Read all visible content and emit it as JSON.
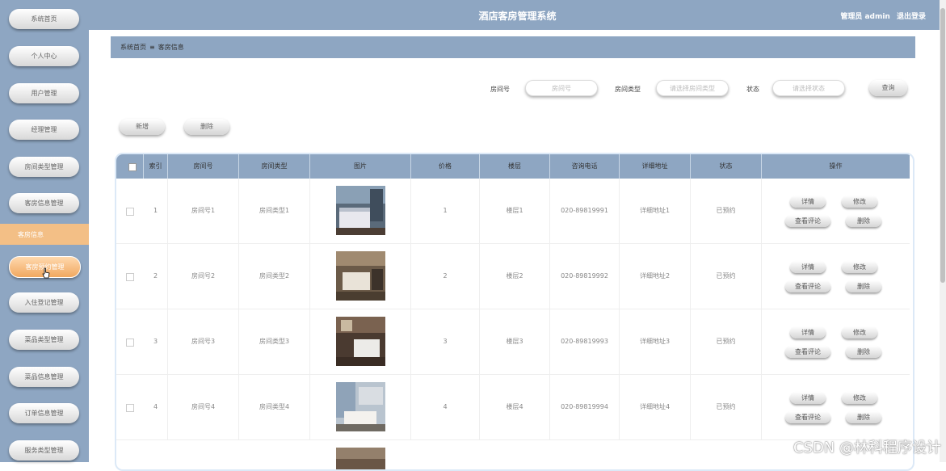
{
  "app": {
    "title": "酒店客房管理系统",
    "user_label": "管理员 admin",
    "logout": "退出登录"
  },
  "sidebar": {
    "items": [
      {
        "label": "系统首页"
      },
      {
        "label": "个人中心"
      },
      {
        "label": "用户管理"
      },
      {
        "label": "经理管理"
      },
      {
        "label": "房间类型管理"
      },
      {
        "label": "客房信息管理"
      },
      {
        "label": "客房预约管理"
      },
      {
        "label": "入住登记管理"
      },
      {
        "label": "菜品类型管理"
      },
      {
        "label": "菜品信息管理"
      },
      {
        "label": "订单信息管理"
      },
      {
        "label": "服务类型管理"
      }
    ],
    "active": "客房信息"
  },
  "breadcrumb": {
    "home": "系统首页",
    "sep": "≡",
    "current": "客房信息"
  },
  "search": {
    "room_no_label": "房间号",
    "room_no_placeholder": "房间号",
    "room_type_label": "房间类型",
    "room_type_placeholder": "请选择房间类型",
    "status_label": "状态",
    "status_placeholder": "请选择状态",
    "query_button": "查询"
  },
  "toolbar": {
    "add": "新增",
    "delete": "删除"
  },
  "table": {
    "headers": [
      "索引",
      "房间号",
      "房间类型",
      "图片",
      "价格",
      "楼层",
      "咨询电话",
      "详细地址",
      "状态",
      "操作"
    ],
    "rows": [
      {
        "idx": "1",
        "room": "房间号1",
        "type": "房间类型1",
        "price": "1",
        "floor": "楼层1",
        "phone": "020-89819991",
        "addr": "详细地址1",
        "status": "已预约"
      },
      {
        "idx": "2",
        "room": "房间号2",
        "type": "房间类型2",
        "price": "2",
        "floor": "楼层2",
        "phone": "020-89819992",
        "addr": "详细地址2",
        "status": "已预约"
      },
      {
        "idx": "3",
        "room": "房间号3",
        "type": "房间类型3",
        "price": "3",
        "floor": "楼层3",
        "phone": "020-89819993",
        "addr": "详细地址3",
        "status": "已预约"
      },
      {
        "idx": "4",
        "room": "房间号4",
        "type": "房间类型4",
        "price": "4",
        "floor": "楼层4",
        "phone": "020-89819994",
        "addr": "详细地址4",
        "status": "已预约"
      }
    ],
    "actions": {
      "detail": "详情",
      "edit": "修改",
      "reviews": "查看评论",
      "delete": "删除"
    }
  },
  "watermark": "CSDN @林科程序设计"
}
